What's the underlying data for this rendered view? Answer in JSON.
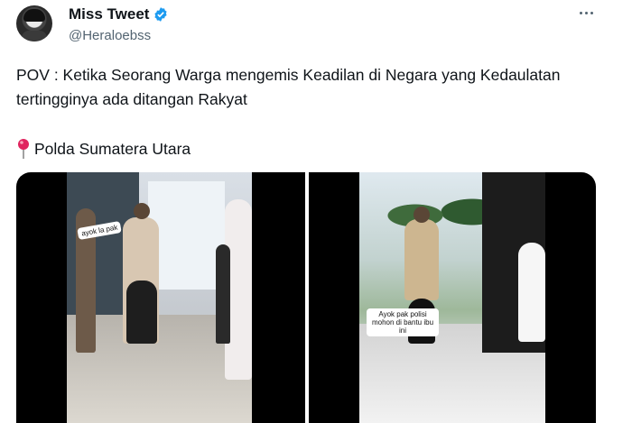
{
  "header": {
    "display_name": "Miss Tweet",
    "handle": "@Heraloebss",
    "verified_icon": "verified-badge-icon",
    "more_icon": "more-options-icon",
    "accent_color": "#1d9bf0"
  },
  "tweet": {
    "text": "POV : Ketika Seorang Warga mengemis Keadilan di Negara yang Kedaulatan tertingginya ada ditangan Rakyat",
    "location_icon": "round-pushpin-icon",
    "location": "Polda Sumatera Utara"
  },
  "media": {
    "video_1_caption": "ayok la pak",
    "video_2_caption": "Ayok pak polisi mohon di bantu ibu ini"
  }
}
